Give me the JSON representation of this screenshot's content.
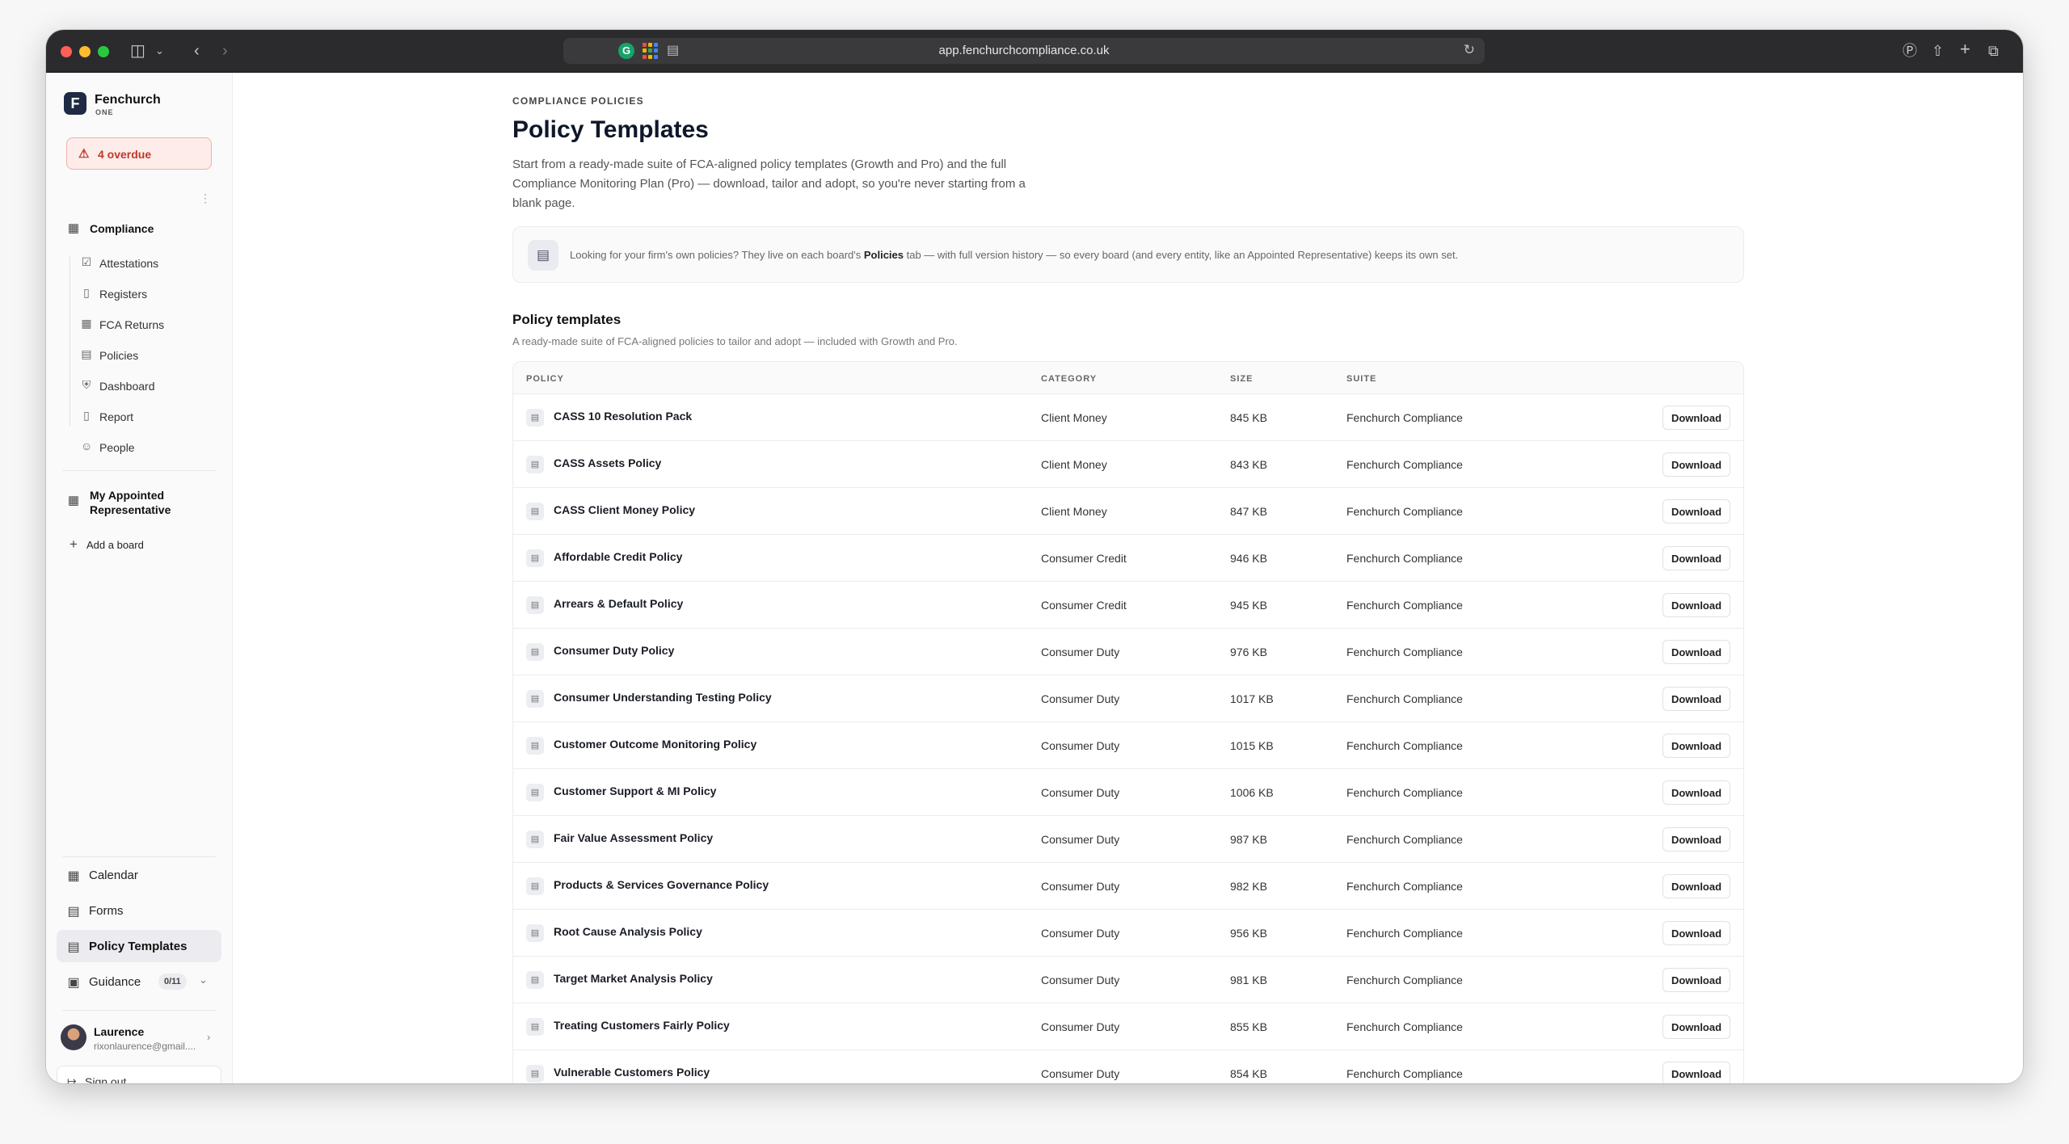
{
  "browser": {
    "url": "app.fenchurchcompliance.co.uk"
  },
  "brand": {
    "mark": "F",
    "name": "Fenchurch",
    "sub": "ONE"
  },
  "alert": {
    "label": "4 overdue",
    "color": "#c0392b"
  },
  "sidebar": {
    "compliance_label": "Compliance",
    "sub_items": [
      {
        "label": "Attestations",
        "icon": "check-square-icon"
      },
      {
        "label": "Registers",
        "icon": "book-icon"
      },
      {
        "label": "FCA Returns",
        "icon": "calendar-icon"
      },
      {
        "label": "Policies",
        "icon": "document-icon"
      },
      {
        "label": "Dashboard",
        "icon": "shield-icon"
      },
      {
        "label": "Report",
        "icon": "file-icon"
      },
      {
        "label": "People",
        "icon": "people-icon"
      }
    ],
    "board_label": "My Appointed Representative",
    "add_board_label": "Add a board",
    "bottom_items": [
      {
        "label": "Calendar",
        "icon": "calendar-icon"
      },
      {
        "label": "Forms",
        "icon": "form-icon"
      },
      {
        "label": "Policy Templates",
        "icon": "document-icon",
        "active": true
      },
      {
        "label": "Guidance",
        "icon": "book-open-icon"
      }
    ],
    "guidance_badge": "0/11"
  },
  "user": {
    "name": "Laurence",
    "email": "rixonlaurence@gmail...."
  },
  "signout_label": "Sign out",
  "page": {
    "eyebrow": "COMPLIANCE POLICIES",
    "title": "Policy Templates",
    "intro": "Start from a ready-made suite of FCA-aligned policy templates (Growth and Pro) and the full Compliance Monitoring Plan (Pro) — download, tailor and adopt, so you're never starting from a blank page.",
    "callout_before": "Looking for your firm's own policies? They live on each board's ",
    "callout_bold": "Policies",
    "callout_after": " tab — with full version history — so every board (and every entity, like an Appointed Representative) keeps its own set.",
    "section_title": "Policy templates",
    "section_sub": "A ready-made suite of FCA-aligned policies to tailor and adopt — included with Growth and Pro."
  },
  "table": {
    "headers": {
      "policy": "POLICY",
      "category": "CATEGORY",
      "size": "SIZE",
      "suite": "SUITE"
    },
    "download_label": "Download",
    "rows": [
      {
        "name": "CASS 10 Resolution Pack",
        "category": "Client Money",
        "size": "845 KB",
        "suite": "Fenchurch Compliance"
      },
      {
        "name": "CASS Assets Policy",
        "category": "Client Money",
        "size": "843 KB",
        "suite": "Fenchurch Compliance"
      },
      {
        "name": "CASS Client Money Policy",
        "category": "Client Money",
        "size": "847 KB",
        "suite": "Fenchurch Compliance"
      },
      {
        "name": "Affordable Credit Policy",
        "category": "Consumer Credit",
        "size": "946 KB",
        "suite": "Fenchurch Compliance"
      },
      {
        "name": "Arrears & Default Policy",
        "category": "Consumer Credit",
        "size": "945 KB",
        "suite": "Fenchurch Compliance"
      },
      {
        "name": "Consumer Duty Policy",
        "category": "Consumer Duty",
        "size": "976 KB",
        "suite": "Fenchurch Compliance"
      },
      {
        "name": "Consumer Understanding Testing Policy",
        "category": "Consumer Duty",
        "size": "1017 KB",
        "suite": "Fenchurch Compliance"
      },
      {
        "name": "Customer Outcome Monitoring Policy",
        "category": "Consumer Duty",
        "size": "1015 KB",
        "suite": "Fenchurch Compliance"
      },
      {
        "name": "Customer Support & MI Policy",
        "category": "Consumer Duty",
        "size": "1006 KB",
        "suite": "Fenchurch Compliance"
      },
      {
        "name": "Fair Value Assessment Policy",
        "category": "Consumer Duty",
        "size": "987 KB",
        "suite": "Fenchurch Compliance"
      },
      {
        "name": "Products & Services Governance Policy",
        "category": "Consumer Duty",
        "size": "982 KB",
        "suite": "Fenchurch Compliance"
      },
      {
        "name": "Root Cause Analysis Policy",
        "category": "Consumer Duty",
        "size": "956 KB",
        "suite": "Fenchurch Compliance"
      },
      {
        "name": "Target Market Analysis Policy",
        "category": "Consumer Duty",
        "size": "981 KB",
        "suite": "Fenchurch Compliance"
      },
      {
        "name": "Treating Customers Fairly Policy",
        "category": "Consumer Duty",
        "size": "855 KB",
        "suite": "Fenchurch Compliance"
      },
      {
        "name": "Vulnerable Customers Policy",
        "category": "Consumer Duty",
        "size": "854 KB",
        "suite": "Fenchurch Compliance"
      }
    ]
  }
}
